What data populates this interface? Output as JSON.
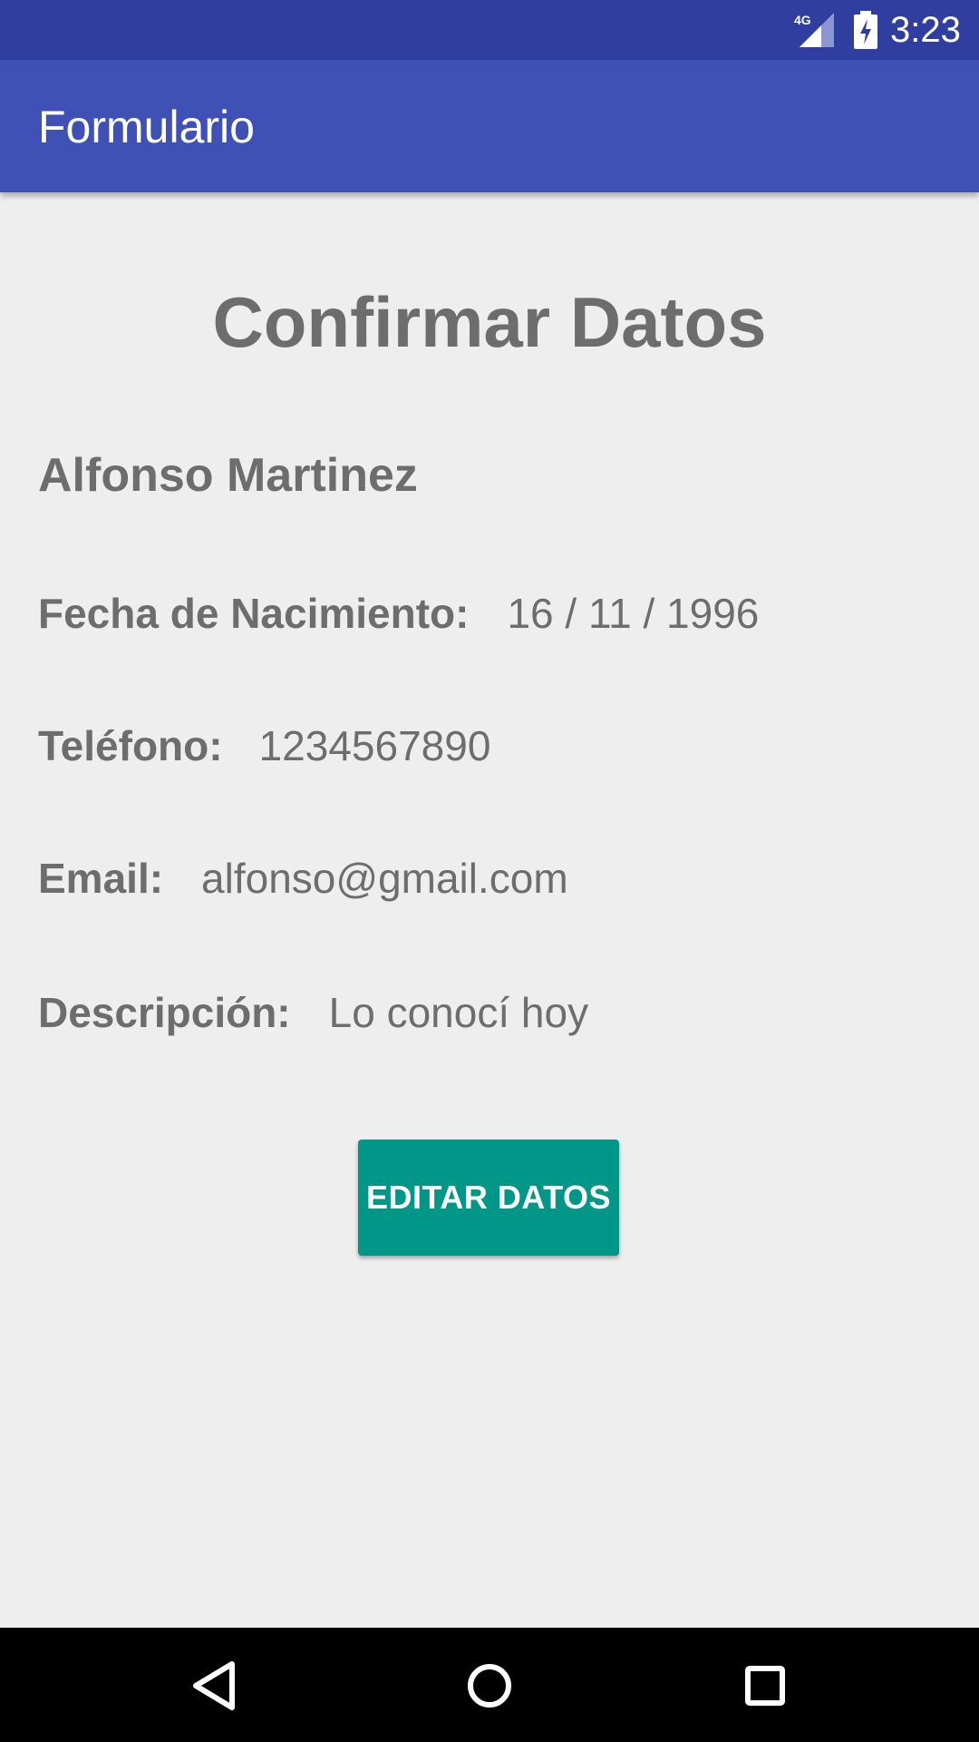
{
  "status_bar": {
    "network": "4G",
    "time": "3:23",
    "icons": [
      "signal-4g-icon",
      "battery-charging-icon"
    ]
  },
  "app_bar": {
    "title": "Formulario",
    "color": "#3f51b5"
  },
  "content": {
    "title": "Confirmar Datos",
    "name": "Alfonso Martinez",
    "fields": {
      "birthdate": {
        "label": "Fecha de Nacimiento:",
        "value": "16 / 11 / 1996"
      },
      "phone": {
        "label": "Teléfono:",
        "value": "1234567890"
      },
      "email": {
        "label": "Email:",
        "value": "alfonso@gmail.com"
      },
      "description": {
        "label": "Descripción:",
        "value": "Lo conocí hoy"
      }
    },
    "edit_button": {
      "label": "EDITAR DATOS",
      "color": "#009688"
    }
  },
  "nav_bar": {
    "icons": [
      "back-icon",
      "home-icon",
      "recents-icon"
    ]
  }
}
